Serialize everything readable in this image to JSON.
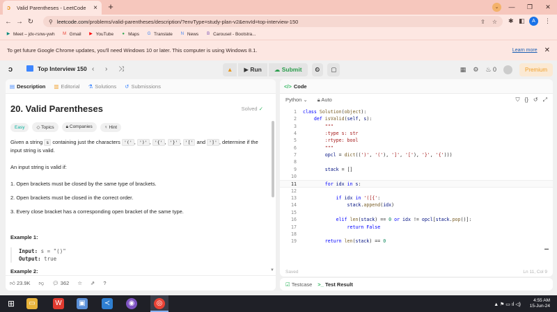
{
  "browser": {
    "tab_title": "Valid Parentheses - LeetCode",
    "tab_close": "×",
    "new_tab": "+",
    "url_host": "leetcode.com",
    "url_path": "/problems/valid-parentheses/description/?envType=study-plan-v2&envId=top-interview-150",
    "profile_initial": "A",
    "bookmarks": [
      {
        "label": "Meet – jdv-rsnw-ywh",
        "icon": "meet-icon",
        "color": "#00897b",
        "glyph": "▶"
      },
      {
        "label": "Gmail",
        "icon": "gmail-icon",
        "color": "#ea4335",
        "glyph": "M"
      },
      {
        "label": "YouTube",
        "icon": "youtube-icon",
        "color": "#ff0000",
        "glyph": "▶"
      },
      {
        "label": "Maps",
        "icon": "maps-icon",
        "color": "#34a853",
        "glyph": "●"
      },
      {
        "label": "Translate",
        "icon": "translate-icon",
        "color": "#4285f4",
        "glyph": "G"
      },
      {
        "label": "News",
        "icon": "news-icon",
        "color": "#4285f4",
        "glyph": "N"
      },
      {
        "label": "Carousel - Bootstra...",
        "icon": "bootstrap-icon",
        "color": "#7952b3",
        "glyph": "B"
      }
    ],
    "infobar_message": "To get future Google Chrome updates, you'll need Windows 10 or later. This computer is using Windows 8.1.",
    "infobar_link": "Learn more"
  },
  "lc_nav": {
    "list_title": "Top Interview 150",
    "run_label": "Run",
    "submit_label": "Submit",
    "fire_count": "0",
    "premium_label": "Premium"
  },
  "left_tabs": {
    "description": "Description",
    "editorial": "Editorial",
    "solutions": "Solutions",
    "submissions": "Submissions"
  },
  "problem": {
    "title": "20. Valid Parentheses",
    "solved": "Solved",
    "tags": [
      "Easy",
      "Topics",
      "Companies",
      "Hint"
    ],
    "p1_a": "Given a string ",
    "p1_s": "s",
    "p1_b": " containing just the characters ",
    "chars": [
      "'('",
      "')'",
      "'{'",
      "'}'",
      "'['"
    ],
    "p1_and": " and ",
    "char_last": "']'",
    "p1_c": ", determine if the input string is valid.",
    "p2": "An input string is valid if:",
    "rules": [
      "1. Open brackets must be closed by the same type of brackets.",
      "2. Open brackets must be closed in the correct order.",
      "3. Every close bracket has a corresponding open bracket of the same type."
    ],
    "example1_title": "Example 1:",
    "example1_input_label": "Input:",
    "example1_input": "s = \"()\"",
    "example1_output_label": "Output:",
    "example1_output": "true",
    "example2_title": "Example 2:"
  },
  "left_footer": {
    "likes": "23.9K",
    "comments": "362"
  },
  "code_panel": {
    "title": "Code",
    "language": "Python",
    "mode": "Auto",
    "saved": "Saved",
    "cursor": "Ln 11, Col 9"
  },
  "code_lines": [
    "1",
    "2",
    "3",
    "4",
    "5",
    "6",
    "7",
    "8",
    "9",
    "10",
    "11",
    "12",
    "13",
    "14",
    "15",
    "16",
    "17",
    "18",
    "19"
  ],
  "bottom_tabs": {
    "testcase": "Testcase",
    "result": "Test Result"
  },
  "taskbar": {
    "time": "4:55 AM",
    "date": "15-Jun-24"
  }
}
